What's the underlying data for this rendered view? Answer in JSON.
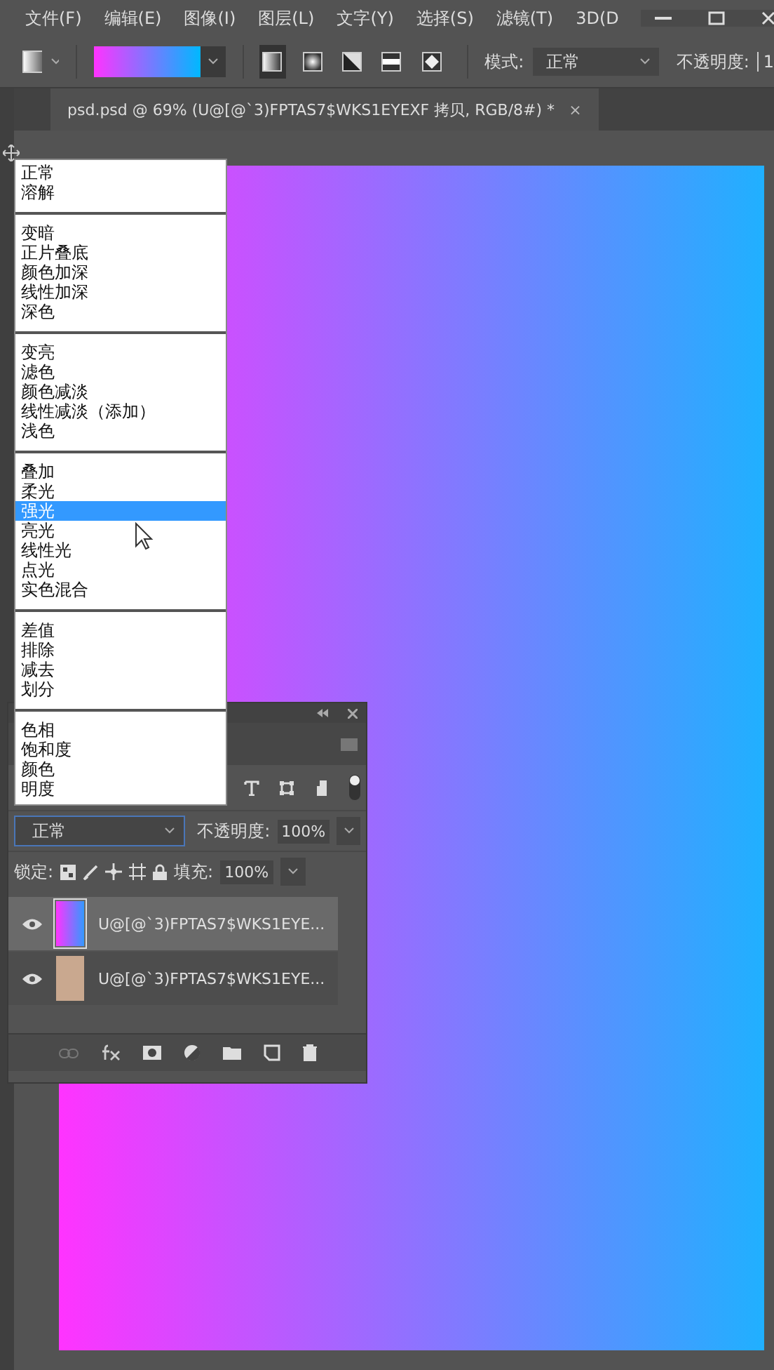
{
  "menubar": {
    "items": [
      "文件(F)",
      "编辑(E)",
      "图像(I)",
      "图层(L)",
      "文字(Y)",
      "选择(S)",
      "滤镜(T)",
      "3D(D"
    ]
  },
  "options_bar": {
    "gradient_styles": [
      {
        "kind": "linear",
        "selected": true
      },
      {
        "kind": "radial",
        "selected": false
      },
      {
        "kind": "angle",
        "selected": false
      },
      {
        "kind": "reflected",
        "selected": false
      },
      {
        "kind": "diamond",
        "selected": false
      }
    ],
    "mode_label": "模式:",
    "mode_value": "正常",
    "opacity_label": "不透明度:",
    "opacity_value": "1"
  },
  "document_tab": {
    "title": "psd.psd @ 69% (U@[@`3)FPTAS7$WKS1EYEXF 拷贝, RGB/8#) *",
    "close": "×"
  },
  "blend_menu": {
    "groups": [
      {
        "items": [
          {
            "label": "正常",
            "selected": false
          },
          {
            "label": "溶解",
            "selected": false
          }
        ]
      },
      {
        "items": [
          {
            "label": "变暗",
            "selected": false
          },
          {
            "label": "正片叠底",
            "selected": false
          },
          {
            "label": "颜色加深",
            "selected": false
          },
          {
            "label": "线性加深",
            "selected": false
          },
          {
            "label": "深色",
            "selected": false
          }
        ]
      },
      {
        "items": [
          {
            "label": "变亮",
            "selected": false
          },
          {
            "label": "滤色",
            "selected": false
          },
          {
            "label": "颜色减淡",
            "selected": false
          },
          {
            "label": "线性减淡（添加）",
            "selected": false
          },
          {
            "label": "浅色",
            "selected": false
          }
        ]
      },
      {
        "items": [
          {
            "label": "叠加",
            "selected": false
          },
          {
            "label": "柔光",
            "selected": false
          },
          {
            "label": "强光",
            "selected": true
          },
          {
            "label": "亮光",
            "selected": false
          },
          {
            "label": "线性光",
            "selected": false
          },
          {
            "label": "点光",
            "selected": false
          },
          {
            "label": "实色混合",
            "selected": false
          }
        ]
      },
      {
        "items": [
          {
            "label": "差值",
            "selected": false
          },
          {
            "label": "排除",
            "selected": false
          },
          {
            "label": "减去",
            "selected": false
          },
          {
            "label": "划分",
            "selected": false
          }
        ]
      },
      {
        "items": [
          {
            "label": "色相",
            "selected": false
          },
          {
            "label": "饱和度",
            "selected": false
          },
          {
            "label": "颜色",
            "selected": false
          },
          {
            "label": "明度",
            "selected": false
          }
        ]
      }
    ]
  },
  "layers_panel": {
    "blend_mode": "正常",
    "opacity_label": "不透明度:",
    "opacity_value": "100%",
    "lock_label": "锁定:",
    "fill_label": "填充:",
    "fill_value": "100%",
    "layers": [
      {
        "kind": "gradient",
        "name": "U@[@`3)FPTAS7$WKS1EYE...",
        "visible": true,
        "selected": true
      },
      {
        "kind": "photo",
        "name": "U@[@`3)FPTAS7$WKS1EYE...",
        "visible": true,
        "selected": false
      }
    ]
  }
}
